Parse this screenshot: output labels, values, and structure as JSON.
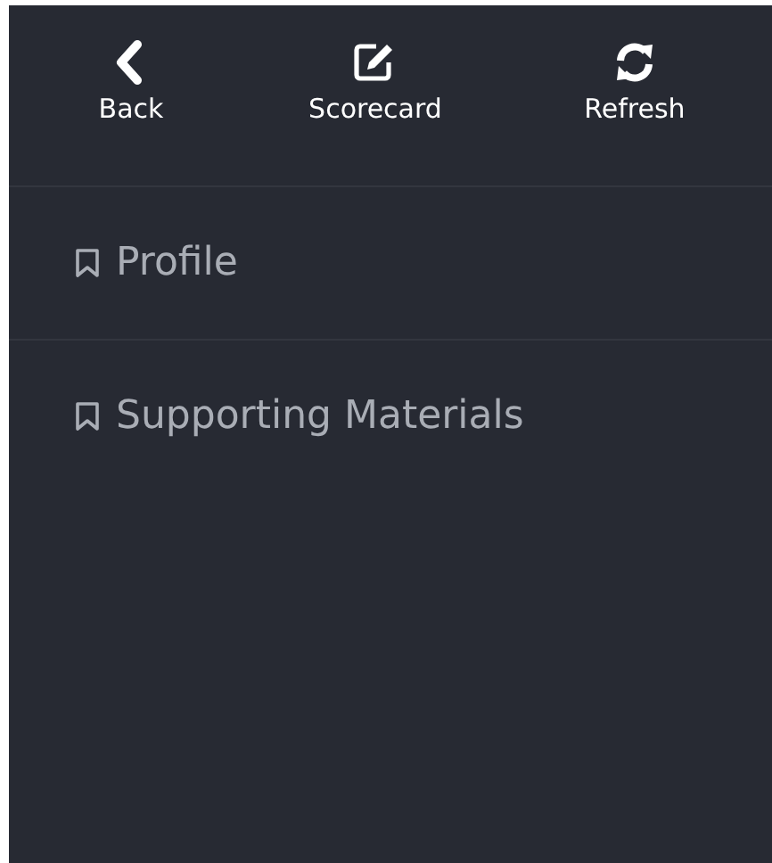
{
  "toolbar": [
    {
      "kind": "back",
      "label": "Back"
    },
    {
      "kind": "edit",
      "label": "Scorecard"
    },
    {
      "kind": "refresh",
      "label": "Refresh"
    }
  ],
  "menu": {
    "items": [
      {
        "label": "Profile"
      },
      {
        "label": "Supporting Materials"
      }
    ]
  }
}
